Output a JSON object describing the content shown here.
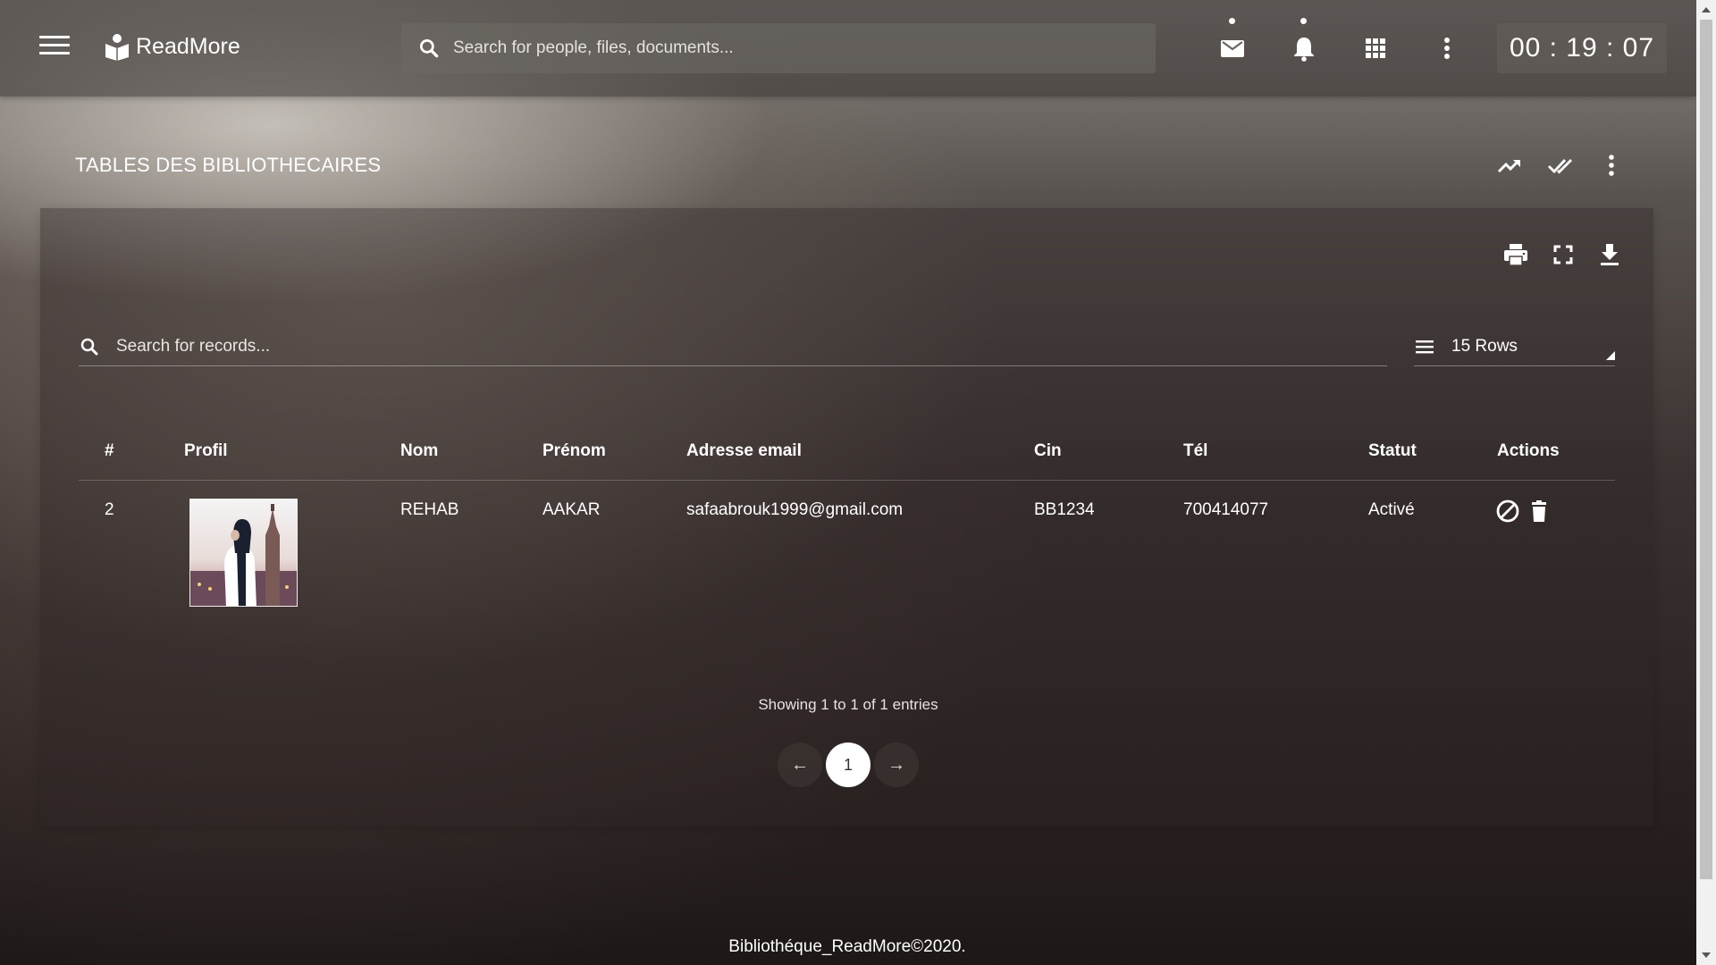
{
  "app": {
    "name": "ReadMore"
  },
  "topbar": {
    "search_placeholder": "Search for people, files, documents...",
    "timer": "00 : 19 : 07",
    "icons": [
      "menu-icon",
      "mail-icon",
      "bell-icon",
      "apps-grid-icon",
      "more-vertical-icon"
    ]
  },
  "page": {
    "title": "TABLES DES BIBLIOTHECAIRES",
    "header_icons": [
      "trending-up-icon",
      "done-all-icon",
      "more-vertical-icon"
    ],
    "card_icons": [
      "print-icon",
      "fullscreen-icon",
      "download-icon"
    ]
  },
  "records": {
    "search_placeholder": "Search for records...",
    "rows_label": "15 Rows"
  },
  "table": {
    "columns": [
      "#",
      "Profil",
      "Nom",
      "Prénom",
      "Adresse email",
      "Cin",
      "Tél",
      "Statut",
      "Actions"
    ],
    "rows": [
      {
        "id": "2",
        "nom": "REHAB",
        "prenom": "AAKAR",
        "email": "safaabrouk1999@gmail.com",
        "cin": "BB1234",
        "tel": "700414077",
        "statut": "Activé",
        "actions": [
          "block-icon",
          "trash-icon"
        ]
      }
    ]
  },
  "pagination": {
    "summary": "Showing 1 to 1 of 1 entries",
    "pages": [
      "1"
    ],
    "current": "1",
    "prev": "←",
    "next": "→"
  },
  "footer": {
    "text": "Bibliothéque_ReadMore©2020."
  }
}
